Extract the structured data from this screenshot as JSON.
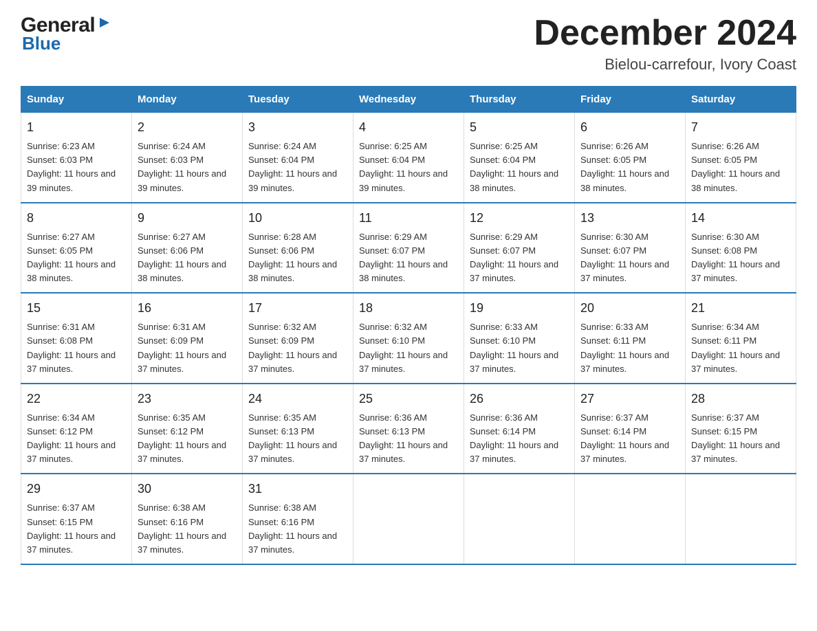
{
  "logo": {
    "text_general": "General",
    "text_blue": "Blue",
    "arrow": "▶"
  },
  "header": {
    "month_title": "December 2024",
    "location": "Bielou-carrefour, Ivory Coast"
  },
  "days_of_week": [
    "Sunday",
    "Monday",
    "Tuesday",
    "Wednesday",
    "Thursday",
    "Friday",
    "Saturday"
  ],
  "weeks": [
    [
      {
        "day": "1",
        "sunrise": "6:23 AM",
        "sunset": "6:03 PM",
        "daylight": "11 hours and 39 minutes."
      },
      {
        "day": "2",
        "sunrise": "6:24 AM",
        "sunset": "6:03 PM",
        "daylight": "11 hours and 39 minutes."
      },
      {
        "day": "3",
        "sunrise": "6:24 AM",
        "sunset": "6:04 PM",
        "daylight": "11 hours and 39 minutes."
      },
      {
        "day": "4",
        "sunrise": "6:25 AM",
        "sunset": "6:04 PM",
        "daylight": "11 hours and 39 minutes."
      },
      {
        "day": "5",
        "sunrise": "6:25 AM",
        "sunset": "6:04 PM",
        "daylight": "11 hours and 38 minutes."
      },
      {
        "day": "6",
        "sunrise": "6:26 AM",
        "sunset": "6:05 PM",
        "daylight": "11 hours and 38 minutes."
      },
      {
        "day": "7",
        "sunrise": "6:26 AM",
        "sunset": "6:05 PM",
        "daylight": "11 hours and 38 minutes."
      }
    ],
    [
      {
        "day": "8",
        "sunrise": "6:27 AM",
        "sunset": "6:05 PM",
        "daylight": "11 hours and 38 minutes."
      },
      {
        "day": "9",
        "sunrise": "6:27 AM",
        "sunset": "6:06 PM",
        "daylight": "11 hours and 38 minutes."
      },
      {
        "day": "10",
        "sunrise": "6:28 AM",
        "sunset": "6:06 PM",
        "daylight": "11 hours and 38 minutes."
      },
      {
        "day": "11",
        "sunrise": "6:29 AM",
        "sunset": "6:07 PM",
        "daylight": "11 hours and 38 minutes."
      },
      {
        "day": "12",
        "sunrise": "6:29 AM",
        "sunset": "6:07 PM",
        "daylight": "11 hours and 37 minutes."
      },
      {
        "day": "13",
        "sunrise": "6:30 AM",
        "sunset": "6:07 PM",
        "daylight": "11 hours and 37 minutes."
      },
      {
        "day": "14",
        "sunrise": "6:30 AM",
        "sunset": "6:08 PM",
        "daylight": "11 hours and 37 minutes."
      }
    ],
    [
      {
        "day": "15",
        "sunrise": "6:31 AM",
        "sunset": "6:08 PM",
        "daylight": "11 hours and 37 minutes."
      },
      {
        "day": "16",
        "sunrise": "6:31 AM",
        "sunset": "6:09 PM",
        "daylight": "11 hours and 37 minutes."
      },
      {
        "day": "17",
        "sunrise": "6:32 AM",
        "sunset": "6:09 PM",
        "daylight": "11 hours and 37 minutes."
      },
      {
        "day": "18",
        "sunrise": "6:32 AM",
        "sunset": "6:10 PM",
        "daylight": "11 hours and 37 minutes."
      },
      {
        "day": "19",
        "sunrise": "6:33 AM",
        "sunset": "6:10 PM",
        "daylight": "11 hours and 37 minutes."
      },
      {
        "day": "20",
        "sunrise": "6:33 AM",
        "sunset": "6:11 PM",
        "daylight": "11 hours and 37 minutes."
      },
      {
        "day": "21",
        "sunrise": "6:34 AM",
        "sunset": "6:11 PM",
        "daylight": "11 hours and 37 minutes."
      }
    ],
    [
      {
        "day": "22",
        "sunrise": "6:34 AM",
        "sunset": "6:12 PM",
        "daylight": "11 hours and 37 minutes."
      },
      {
        "day": "23",
        "sunrise": "6:35 AM",
        "sunset": "6:12 PM",
        "daylight": "11 hours and 37 minutes."
      },
      {
        "day": "24",
        "sunrise": "6:35 AM",
        "sunset": "6:13 PM",
        "daylight": "11 hours and 37 minutes."
      },
      {
        "day": "25",
        "sunrise": "6:36 AM",
        "sunset": "6:13 PM",
        "daylight": "11 hours and 37 minutes."
      },
      {
        "day": "26",
        "sunrise": "6:36 AM",
        "sunset": "6:14 PM",
        "daylight": "11 hours and 37 minutes."
      },
      {
        "day": "27",
        "sunrise": "6:37 AM",
        "sunset": "6:14 PM",
        "daylight": "11 hours and 37 minutes."
      },
      {
        "day": "28",
        "sunrise": "6:37 AM",
        "sunset": "6:15 PM",
        "daylight": "11 hours and 37 minutes."
      }
    ],
    [
      {
        "day": "29",
        "sunrise": "6:37 AM",
        "sunset": "6:15 PM",
        "daylight": "11 hours and 37 minutes."
      },
      {
        "day": "30",
        "sunrise": "6:38 AM",
        "sunset": "6:16 PM",
        "daylight": "11 hours and 37 minutes."
      },
      {
        "day": "31",
        "sunrise": "6:38 AM",
        "sunset": "6:16 PM",
        "daylight": "11 hours and 37 minutes."
      },
      {
        "day": "",
        "sunrise": "",
        "sunset": "",
        "daylight": ""
      },
      {
        "day": "",
        "sunrise": "",
        "sunset": "",
        "daylight": ""
      },
      {
        "day": "",
        "sunrise": "",
        "sunset": "",
        "daylight": ""
      },
      {
        "day": "",
        "sunrise": "",
        "sunset": "",
        "daylight": ""
      }
    ]
  ],
  "labels": {
    "sunrise_prefix": "Sunrise: ",
    "sunset_prefix": "Sunset: ",
    "daylight_prefix": "Daylight: "
  }
}
